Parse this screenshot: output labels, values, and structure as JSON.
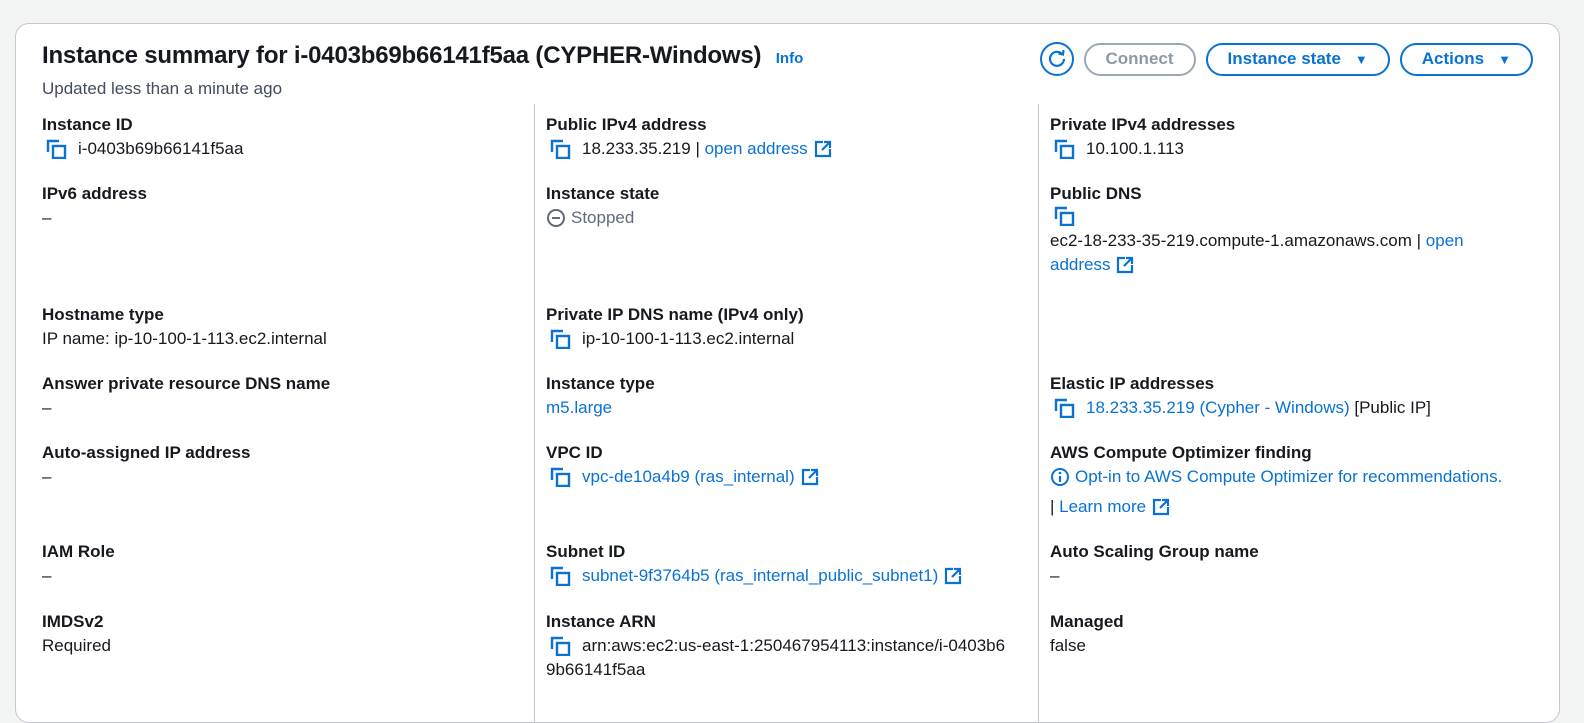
{
  "header": {
    "title": "Instance summary for i-0403b69b66141f5aa (CYPHER-Windows)",
    "info": "Info",
    "updated": "Updated less than a minute ago",
    "connect": "Connect",
    "instance_state": "Instance state",
    "actions": "Actions"
  },
  "col1": {
    "instance_id": {
      "label": "Instance ID",
      "value": "i-0403b69b66141f5aa"
    },
    "ipv6": {
      "label": "IPv6 address",
      "value": "–"
    },
    "hostname_type": {
      "label": "Hostname type",
      "value": "IP name: ip-10-100-1-113.ec2.internal"
    },
    "answer_dns": {
      "label": "Answer private resource DNS name",
      "value": "–"
    },
    "auto_ip": {
      "label": "Auto-assigned IP address",
      "value": "–"
    },
    "iam_role": {
      "label": "IAM Role",
      "value": "–"
    },
    "imdsv2": {
      "label": "IMDSv2",
      "value": "Required"
    }
  },
  "col2": {
    "public_ipv4": {
      "label": "Public IPv4 address",
      "value": "18.233.35.219",
      "sep": " | ",
      "link": "open address"
    },
    "instance_state": {
      "label": "Instance state",
      "value": "Stopped"
    },
    "private_dns": {
      "label": "Private IP DNS name (IPv4 only)",
      "value": "ip-10-100-1-113.ec2.internal"
    },
    "instance_type": {
      "label": "Instance type",
      "value": "m5.large"
    },
    "vpc_id": {
      "label": "VPC ID",
      "value": "vpc-de10a4b9 (ras_internal)"
    },
    "subnet_id": {
      "label": "Subnet ID",
      "value": "subnet-9f3764b5 (ras_internal_public_subnet1)"
    },
    "instance_arn": {
      "label": "Instance ARN",
      "line1": "arn:aws:ec2:us-east-1:250467954113:instance/i-0403b6",
      "line2": "9b66141f5aa"
    }
  },
  "col3": {
    "private_ipv4": {
      "label": "Private IPv4 addresses",
      "value": "10.100.1.113"
    },
    "public_dns": {
      "label": "Public DNS",
      "value": "ec2-18-233-35-219.compute-1.amazonaws.com",
      "sep": " | ",
      "link1": "open",
      "link2": "address"
    },
    "elastic_ip": {
      "label": "Elastic IP addresses",
      "value": "18.233.35.219 (Cypher - Windows)",
      "suffix": " [Public IP]"
    },
    "optimizer": {
      "label": "AWS Compute Optimizer finding",
      "link": "Opt-in to AWS Compute Optimizer for recommendations.",
      "sep": "| ",
      "learn": "Learn more"
    },
    "asg": {
      "label": "Auto Scaling Group name",
      "value": "–"
    },
    "managed": {
      "label": "Managed",
      "value": "false"
    }
  },
  "colors": {
    "link": "#0972d3",
    "border": "#c6c6cd",
    "text": "#16191f"
  }
}
